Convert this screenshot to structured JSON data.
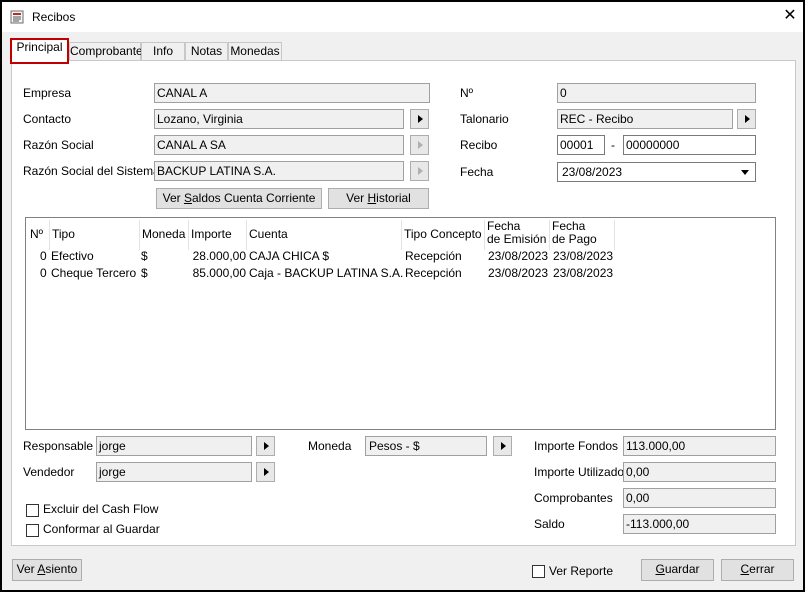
{
  "window": {
    "title": "Recibos",
    "close_glyph": "✕"
  },
  "tabs": [
    "Principal",
    "Comprobantes",
    "Info",
    "Notas",
    "Monedas"
  ],
  "form": {
    "empresa_label": "Empresa",
    "empresa_value": "CANAL A",
    "contacto_label": "Contacto",
    "contacto_value": "Lozano, Virginia",
    "razon_label": "Razón Social",
    "razon_value": "CANAL A SA",
    "razon_sistema_label": "Razón Social del Sistema",
    "razon_sistema_value": "BACKUP LATINA S.A.",
    "numero_label": "Nº",
    "numero_value": "0",
    "talonario_label": "Talonario",
    "talonario_value": "REC - Recibo",
    "recibo_label": "Recibo",
    "recibo_prefix": "00001",
    "recibo_dash": "-",
    "recibo_number": "00000000",
    "fecha_label": "Fecha",
    "fecha_value": "23/08/2023",
    "btn_saldos_pre": "Ver ",
    "btn_saldos_u": "S",
    "btn_saldos_post": "aldos Cuenta Corriente",
    "btn_historial_pre": "Ver ",
    "btn_historial_u": "H",
    "btn_historial_post": "istorial"
  },
  "grid": {
    "headers": {
      "num": "Nº",
      "tipo": "Tipo",
      "moneda": "Moneda",
      "importe": "Importe",
      "cuenta": "Cuenta",
      "tipo_concepto": "Tipo Concepto",
      "fecha_emision": "Fecha\nde Emisión",
      "fecha_pago": "Fecha\nde Pago"
    },
    "rows": [
      {
        "num": "0",
        "tipo": "Efectivo",
        "moneda": "$",
        "importe": "28.000,00",
        "cuenta": "CAJA CHICA $",
        "tipo_concepto": "Recepción",
        "fecha_emision": "23/08/2023",
        "fecha_pago": "23/08/2023"
      },
      {
        "num": "0",
        "tipo": "Cheque Tercero",
        "moneda": "$",
        "importe": "85.000,00",
        "cuenta": "Caja - BACKUP LATINA S.A.",
        "tipo_concepto": "Recepción",
        "fecha_emision": "23/08/2023",
        "fecha_pago": "23/08/2023"
      }
    ]
  },
  "bottom": {
    "responsable_label": "Responsable",
    "responsable_value": "jorge",
    "vendedor_label": "Vendedor",
    "vendedor_value": "jorge",
    "moneda_label": "Moneda",
    "moneda_value": "Pesos - $",
    "importe_fondos_label": "Importe Fondos",
    "importe_fondos_value": "113.000,00",
    "importe_utilizado_label": "Importe Utilizado",
    "importe_utilizado_value": "0,00",
    "comprobantes_label": "Comprobantes",
    "comprobantes_value": "0,00",
    "saldo_label": "Saldo",
    "saldo_value": "-113.000,00",
    "excluir_label": "Excluir del Cash Flow",
    "conformar_label": "Conformar al Guardar"
  },
  "footer": {
    "ver_asiento_pre": "Ver ",
    "ver_asiento_u": "A",
    "ver_asiento_post": "siento",
    "ver_reporte_label": "Ver Reporte",
    "guardar_u": "G",
    "guardar_post": "uardar",
    "cerrar_u": "C",
    "cerrar_post": "errar"
  }
}
